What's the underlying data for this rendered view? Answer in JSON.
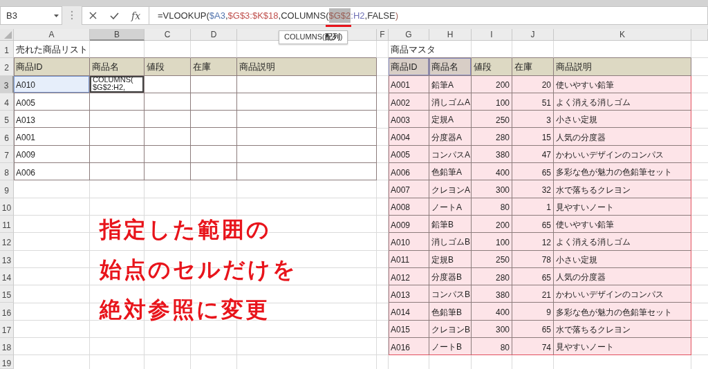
{
  "formula_bar": {
    "name_box": "B3",
    "function_label": "fx",
    "tokens": [
      {
        "text": "=VLOOKUP(",
        "kind": "text",
        "selected": false
      },
      {
        "text": "$A3",
        "kind": "reference",
        "color": "#5274ad",
        "selected": false
      },
      {
        "text": ",",
        "kind": "text",
        "selected": false
      },
      {
        "text": "$G$3:$K$18",
        "kind": "reference",
        "color": "#c0504d",
        "selected": false
      },
      {
        "text": ",COLUMNS(",
        "kind": "text",
        "selected": false
      },
      {
        "text": "$G$2",
        "kind": "reference",
        "color": "#9a5e55",
        "selected": true
      },
      {
        "text": ":H2",
        "kind": "reference",
        "color": "#6f70b5",
        "selected": false
      },
      {
        "text": ",FALSE",
        "kind": "text",
        "selected": false
      },
      {
        "text": ")",
        "kind": "paren",
        "color": "#a0645a",
        "selected": false
      }
    ]
  },
  "tooltip": "COLUMNS(**配列**)",
  "column_headers": [
    {
      "label": "A",
      "selected": false
    },
    {
      "label": "B",
      "selected": true
    },
    {
      "label": "C",
      "selected": false
    },
    {
      "label": "D",
      "selected": false
    },
    {
      "selected": false
    },
    {
      "label": "F",
      "selected": false
    },
    {
      "label": "G",
      "selected": false
    },
    {
      "label": "H",
      "selected": false
    },
    {
      "label": "I",
      "selected": false
    },
    {
      "label": "J",
      "selected": false
    },
    {
      "label": "K",
      "selected": false
    },
    {
      "selected": false
    }
  ],
  "row_headers": [
    {
      "label": "1",
      "selected": false
    },
    {
      "label": "2",
      "selected": false
    },
    {
      "label": "3",
      "selected": true
    },
    {
      "label": "4",
      "selected": false
    },
    {
      "label": "5",
      "selected": false
    },
    {
      "label": "6",
      "selected": false
    },
    {
      "label": "7",
      "selected": false
    },
    {
      "label": "8",
      "selected": false
    },
    {
      "label": "9",
      "selected": false
    },
    {
      "label": "10",
      "selected": false
    },
    {
      "label": "11",
      "selected": false
    },
    {
      "label": "12",
      "selected": false
    },
    {
      "label": "13",
      "selected": false
    },
    {
      "label": "14",
      "selected": false
    },
    {
      "label": "15",
      "selected": false
    },
    {
      "label": "16",
      "selected": false
    },
    {
      "label": "17",
      "selected": false
    },
    {
      "label": "18",
      "selected": false
    },
    {
      "label": "19",
      "selected": false
    }
  ],
  "sold_list": {
    "title": "売れた商品リスト",
    "columns": [
      "商品ID",
      "商品名",
      "値段",
      "在庫",
      "商品説明"
    ],
    "rows": [
      {
        "id": "A010",
        "highlighted": true,
        "name_editor": [
          "COLUMNS(",
          "$G$2:H2,"
        ]
      },
      {
        "id": "A005",
        "highlighted": false
      },
      {
        "id": "A013",
        "highlighted": false
      },
      {
        "id": "A001",
        "highlighted": false
      },
      {
        "id": "A009",
        "highlighted": false
      },
      {
        "id": "A006",
        "highlighted": false
      }
    ]
  },
  "product_master": {
    "title": "商品マスタ",
    "highlighted": true,
    "columns": [
      {
        "label": "商品ID",
        "highlighted": true
      },
      {
        "label": "商品名",
        "highlighted": true
      },
      {
        "label": "値段",
        "highlighted": false
      },
      {
        "label": "在庫",
        "highlighted": false
      },
      {
        "label": "商品説明",
        "highlighted": false
      }
    ],
    "rows": [
      {
        "id": "A001",
        "name": "鉛筆A",
        "price": "200",
        "stock": "20",
        "description": "使いやすい鉛筆"
      },
      {
        "id": "A002",
        "name": "消しゴムA",
        "price": "100",
        "stock": "51",
        "description": "よく消える消しゴム"
      },
      {
        "id": "A003",
        "name": "定規A",
        "price": "250",
        "stock": "3",
        "description": "小さい定規"
      },
      {
        "id": "A004",
        "name": "分度器A",
        "price": "280",
        "stock": "15",
        "description": "人気の分度器"
      },
      {
        "id": "A005",
        "name": "コンパスA",
        "price": "380",
        "stock": "47",
        "description": "かわいいデザインのコンパス"
      },
      {
        "id": "A006",
        "name": "色鉛筆A",
        "price": "400",
        "stock": "65",
        "description": "多彩な色が魅力の色鉛筆セット"
      },
      {
        "id": "A007",
        "name": "クレヨンA",
        "price": "300",
        "stock": "32",
        "description": "水で落ちるクレヨン"
      },
      {
        "id": "A008",
        "name": "ノートA",
        "price": "80",
        "stock": "1",
        "description": "見やすいノート"
      },
      {
        "id": "A009",
        "name": "鉛筆B",
        "price": "200",
        "stock": "65",
        "description": "使いやすい鉛筆"
      },
      {
        "id": "A010",
        "name": "消しゴムB",
        "price": "100",
        "stock": "12",
        "description": "よく消える消しゴム"
      },
      {
        "id": "A011",
        "name": "定規B",
        "price": "250",
        "stock": "78",
        "description": "小さい定規"
      },
      {
        "id": "A012",
        "name": "分度器B",
        "price": "280",
        "stock": "65",
        "description": "人気の分度器"
      },
      {
        "id": "A013",
        "name": "コンパスB",
        "price": "380",
        "stock": "21",
        "description": "かわいいデザインのコンパス"
      },
      {
        "id": "A014",
        "name": "色鉛筆B",
        "price": "400",
        "stock": "9",
        "description": "多彩な色が魅力の色鉛筆セット"
      },
      {
        "id": "A015",
        "name": "クレヨンB",
        "price": "300",
        "stock": "65",
        "description": "水で落ちるクレヨン"
      },
      {
        "id": "A016",
        "name": "ノートB",
        "price": "80",
        "stock": "74",
        "description": "見やすいノート"
      }
    ]
  },
  "annotation": [
    "指定した範囲の",
    "始点のセルだけを",
    "絶対参照に変更"
  ]
}
